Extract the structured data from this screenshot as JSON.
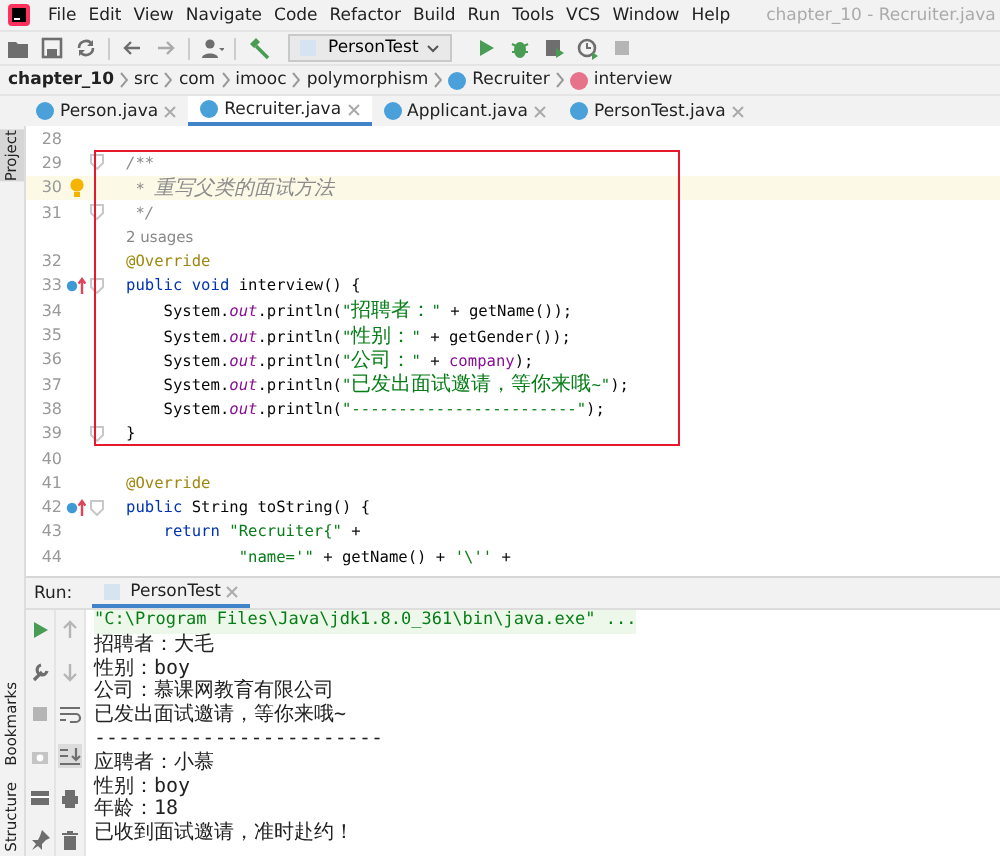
{
  "window": {
    "title": "chapter_10 - Recruiter.java"
  },
  "menu": [
    "File",
    "Edit",
    "View",
    "Navigate",
    "Code",
    "Refactor",
    "Build",
    "Run",
    "Tools",
    "VCS",
    "Window",
    "Help"
  ],
  "toolbar": {
    "run_config": "PersonTest"
  },
  "breadcrumb": [
    {
      "label": "chapter_10",
      "kind": "project"
    },
    {
      "label": "src",
      "kind": "folder"
    },
    {
      "label": "com",
      "kind": "folder"
    },
    {
      "label": "imooc",
      "kind": "folder"
    },
    {
      "label": "polymorphism",
      "kind": "folder"
    },
    {
      "label": "Recruiter",
      "kind": "class"
    },
    {
      "label": "interview",
      "kind": "method"
    }
  ],
  "tabs": [
    {
      "label": "Person.java",
      "selected": false
    },
    {
      "label": "Recruiter.java",
      "selected": true
    },
    {
      "label": "Applicant.java",
      "selected": false
    },
    {
      "label": "PersonTest.java",
      "selected": false
    }
  ],
  "side_tools_top": [
    {
      "label": "Project",
      "selected": true
    }
  ],
  "side_tools_bottom": [
    {
      "label": "Bookmarks",
      "selected": false
    },
    {
      "label": "Structure",
      "selected": false
    }
  ],
  "editor": {
    "blocks": [
      {
        "boxed": false,
        "lines": [
          {
            "kind": "plain",
            "number": "28",
            "current": false,
            "fold": false
          }
        ]
      },
      {
        "boxed": true,
        "lines": [
          {
            "kind": "plain",
            "number": "29",
            "current": false,
            "fold": true,
            "segments": [
              {
                "kind": "comment",
                "text": "/**"
              }
            ]
          },
          {
            "kind": "bulb",
            "number": "30",
            "current": true,
            "fold": false,
            "segments": [
              {
                "kind": "comment",
                "text": " * 重写父类的面试方法"
              }
            ]
          },
          {
            "kind": "plain",
            "number": "31",
            "current": false,
            "fold": true,
            "segments": [
              {
                "kind": "comment",
                "text": " */"
              }
            ]
          },
          {
            "kind": "hint",
            "text": "2 usages"
          },
          {
            "kind": "plain",
            "number": "32",
            "current": false,
            "fold": false,
            "segments": [
              {
                "kind": "annotation",
                "text": "@Override"
              }
            ]
          },
          {
            "kind": "override",
            "number": "33",
            "current": false,
            "fold": true,
            "segments": [
              {
                "kind": "keyword",
                "text": "public void "
              },
              {
                "kind": "plain",
                "text": "interview() {"
              }
            ]
          },
          {
            "kind": "plain",
            "number": "34",
            "current": false,
            "fold": false,
            "segments": [
              {
                "kind": "plain",
                "text": "    System."
              },
              {
                "kind": "static",
                "text": "out"
              },
              {
                "kind": "plain",
                "text": ".println("
              },
              {
                "kind": "string",
                "text": "\"招聘者：\""
              },
              {
                "kind": "plain",
                "text": " + getName());"
              }
            ]
          },
          {
            "kind": "plain",
            "number": "35",
            "current": false,
            "fold": false,
            "segments": [
              {
                "kind": "plain",
                "text": "    System."
              },
              {
                "kind": "static",
                "text": "out"
              },
              {
                "kind": "plain",
                "text": ".println("
              },
              {
                "kind": "string",
                "text": "\"性别：\""
              },
              {
                "kind": "plain",
                "text": " + getGender());"
              }
            ]
          },
          {
            "kind": "plain",
            "number": "36",
            "current": false,
            "fold": false,
            "segments": [
              {
                "kind": "plain",
                "text": "    System."
              },
              {
                "kind": "static",
                "text": "out"
              },
              {
                "kind": "plain",
                "text": ".println("
              },
              {
                "kind": "string",
                "text": "\"公司：\""
              },
              {
                "kind": "plain",
                "text": " + "
              },
              {
                "kind": "field",
                "text": "company"
              },
              {
                "kind": "plain",
                "text": ");"
              }
            ]
          },
          {
            "kind": "plain",
            "number": "37",
            "current": false,
            "fold": false,
            "segments": [
              {
                "kind": "plain",
                "text": "    System."
              },
              {
                "kind": "static",
                "text": "out"
              },
              {
                "kind": "plain",
                "text": ".println("
              },
              {
                "kind": "string",
                "text": "\"已发出面试邀请，等你来哦~\""
              },
              {
                "kind": "plain",
                "text": ");"
              }
            ]
          },
          {
            "kind": "plain",
            "number": "38",
            "current": false,
            "fold": false,
            "segments": [
              {
                "kind": "plain",
                "text": "    System."
              },
              {
                "kind": "static",
                "text": "out"
              },
              {
                "kind": "plain",
                "text": ".println("
              },
              {
                "kind": "string",
                "text": "\"------------------------\""
              },
              {
                "kind": "plain",
                "text": ");"
              }
            ]
          },
          {
            "kind": "plain",
            "number": "39",
            "current": false,
            "fold": true,
            "segments": [
              {
                "kind": "plain",
                "text": "}"
              }
            ]
          }
        ]
      },
      {
        "boxed": false,
        "lines": [
          {
            "kind": "plain",
            "number": "40",
            "current": false,
            "fold": false
          },
          {
            "kind": "plain",
            "number": "41",
            "current": false,
            "fold": false,
            "segments": [
              {
                "kind": "annotation",
                "text": "@Override"
              }
            ]
          },
          {
            "kind": "override",
            "number": "42",
            "current": false,
            "fold": true,
            "segments": [
              {
                "kind": "keyword",
                "text": "public "
              },
              {
                "kind": "plain",
                "text": "String toString() {"
              }
            ]
          },
          {
            "kind": "plain",
            "number": "43",
            "current": false,
            "fold": false,
            "segments": [
              {
                "kind": "keyword",
                "text": "    return "
              },
              {
                "kind": "string",
                "text": "\"Recruiter{\""
              },
              {
                "kind": "plain",
                "text": " +"
              }
            ]
          },
          {
            "kind": "plain",
            "number": "44",
            "current": false,
            "fold": false,
            "segments": [
              {
                "kind": "string",
                "text": "            \"name='\""
              },
              {
                "kind": "plain",
                "text": " + getName() + "
              },
              {
                "kind": "string",
                "text": "'\\''"
              },
              {
                "kind": "plain",
                "text": " +"
              }
            ]
          }
        ]
      }
    ]
  },
  "run_panel": {
    "label": "Run:",
    "tab": "PersonTest",
    "output": [
      {
        "kind": "command",
        "text": "\"C:\\Program Files\\Java\\jdk1.8.0_361\\bin\\java.exe\" ..."
      },
      {
        "kind": "output",
        "text": "招聘者：大毛"
      },
      {
        "kind": "output",
        "text": "性别：boy"
      },
      {
        "kind": "output",
        "text": "公司：慕课网教育有限公司"
      },
      {
        "kind": "output",
        "text": "已发出面试邀请，等你来哦~"
      },
      {
        "kind": "output",
        "text": "------------------------"
      },
      {
        "kind": "output",
        "text": "应聘者：小慕"
      },
      {
        "kind": "output",
        "text": "性别：boy"
      },
      {
        "kind": "output",
        "text": "年龄：18"
      },
      {
        "kind": "output",
        "text": "已收到面试邀请，准时赴约！"
      }
    ]
  }
}
